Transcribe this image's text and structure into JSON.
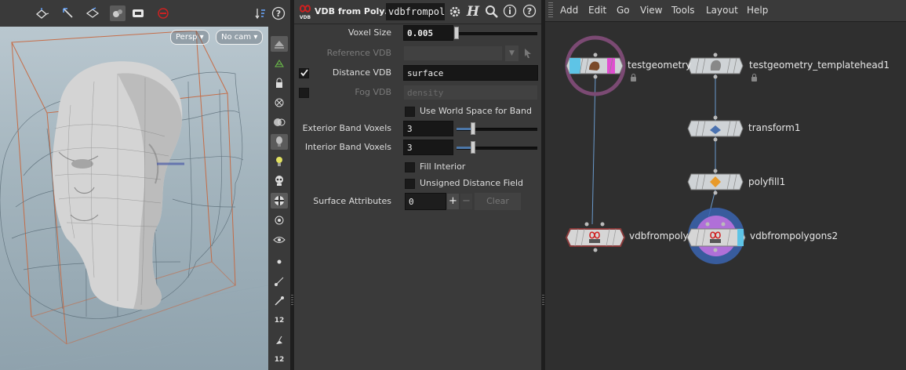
{
  "viewport": {
    "camera_persp": "Persp ▾",
    "camera_name": "No cam ▾",
    "toolbar_icons": [
      "handle-tool-icon",
      "select-tool-icon",
      "transform-tool-icon",
      "snap-icon",
      "display-options-icon",
      "no-record-icon",
      "sort-icon",
      "help-icon"
    ],
    "side_icons": [
      "shading-mode-icon",
      "wireframe-icon",
      "lock-camera-icon",
      "ghost-icon",
      "lights-icon",
      "headlight-icon",
      "bulb-icon",
      "skull-icon",
      "checker-icon",
      "visibility-icon",
      "visibility-b-icon",
      "point-icon",
      "normal-icon",
      "pen-icon",
      "number-12-icon",
      "brush-icon",
      "number-12b-icon"
    ],
    "side_text": {
      "num1": "12",
      "num2": "12"
    }
  },
  "params": {
    "node_type": "VDB from Poly…",
    "node_name": "vdbfrompol",
    "voxel_size": {
      "label": "Voxel Size",
      "value": "0.005",
      "fraction": 0.0
    },
    "reference_vdb": {
      "label": "Reference VDB",
      "value": ""
    },
    "distance_vdb": {
      "label": "Distance VDB",
      "value": "surface",
      "checked": true
    },
    "fog_vdb": {
      "label": "Fog VDB",
      "value": "density",
      "checked": false
    },
    "use_world_space": {
      "label": "Use World Space for Band",
      "checked": false
    },
    "exterior_band": {
      "label": "Exterior Band Voxels",
      "value": "3",
      "fraction": 0.2
    },
    "interior_band": {
      "label": "Interior Band Voxels",
      "value": "3",
      "fraction": 0.2
    },
    "fill_interior": {
      "label": "Fill Interior",
      "checked": false
    },
    "unsigned_df": {
      "label": "Unsigned Distance Field",
      "checked": false
    },
    "surface_attrs": {
      "label": "Surface Attributes",
      "value": "0",
      "plus": "+",
      "minus": "−",
      "clear": "Clear"
    }
  },
  "network": {
    "menu": [
      "Add",
      "Edit",
      "Go",
      "View",
      "Tools",
      "Layout",
      "Help"
    ],
    "nodes": {
      "testgeometry": "testgeometry",
      "templatehead": "testgeometry_templatehead1",
      "transform": "transform1",
      "polyfill": "polyfill1",
      "vdb1": "vdbfrompoly",
      "vdb2": "vdbfrompolygons2"
    }
  },
  "colors": {
    "accent_blue": "#4c77a8",
    "node_cyan": "#5ec4e6",
    "node_pink": "#e04fd0",
    "vdb_red": "#d02020",
    "selection_purple": "#8a4a7a",
    "display_blue": "#3a64b0",
    "template_violet": "#b070d8"
  }
}
